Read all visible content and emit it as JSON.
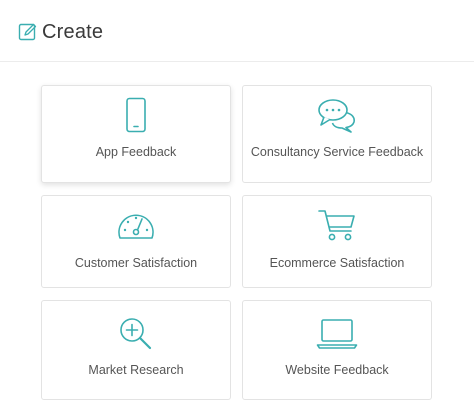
{
  "header": {
    "title": "Create"
  },
  "colors": {
    "accent": "#3aaeb0",
    "card_border": "#e3e3e3",
    "text": "#555555"
  },
  "cards": [
    {
      "label": "App Feedback",
      "icon": "mobile-phone-icon"
    },
    {
      "label": "Consultancy Service Feedback",
      "icon": "chat-bubbles-icon"
    },
    {
      "label": "Customer Satisfaction",
      "icon": "speedometer-icon"
    },
    {
      "label": "Ecommerce Satisfaction",
      "icon": "shopping-cart-icon"
    },
    {
      "label": "Market Research",
      "icon": "magnifier-plus-icon"
    },
    {
      "label": "Website Feedback",
      "icon": "laptop-icon"
    }
  ]
}
